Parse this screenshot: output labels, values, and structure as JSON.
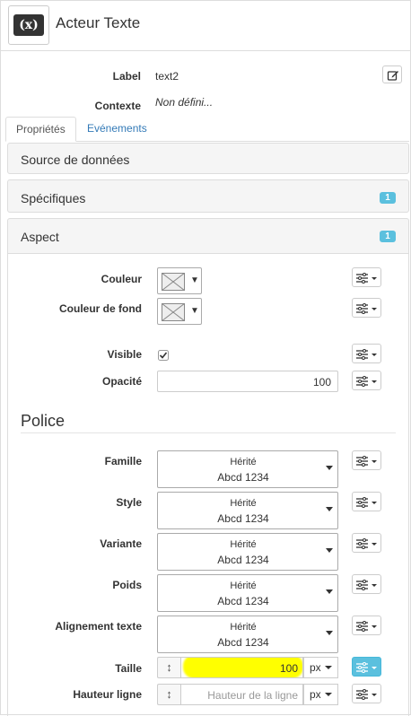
{
  "header": {
    "icon_text": "(x)",
    "title": "Acteur Texte"
  },
  "meta": {
    "label_label": "Label",
    "label_value": "text2",
    "contexte_label": "Contexte",
    "contexte_value": "Non défini..."
  },
  "tabs": [
    {
      "label": "Propriétés",
      "active": true
    },
    {
      "label": "Evénements",
      "active": false
    }
  ],
  "panels": {
    "source": {
      "title": "Source de données"
    },
    "specifiques": {
      "title": "Spécifiques",
      "badge": "1"
    },
    "aspect": {
      "title": "Aspect",
      "badge": "1"
    }
  },
  "aspect": {
    "couleur_label": "Couleur",
    "couleur_fond_label": "Couleur de fond",
    "visible_label": "Visible",
    "visible_checked": true,
    "opacite_label": "Opacité",
    "opacite_value": "100"
  },
  "police": {
    "heading": "Police",
    "rows": [
      {
        "label": "Famille",
        "line1": "Hérité",
        "line2": "Abcd 1234"
      },
      {
        "label": "Style",
        "line1": "Hérité",
        "line2": "Abcd 1234"
      },
      {
        "label": "Variante",
        "line1": "Hérité",
        "line2": "Abcd 1234"
      },
      {
        "label": "Poids",
        "line1": "Hérité",
        "line2": "Abcd 1234"
      },
      {
        "label": "Alignement texte",
        "line1": "Hérité",
        "line2": "Abcd 1234"
      }
    ],
    "taille": {
      "label": "Taille",
      "value": "100",
      "unit": "px"
    },
    "hauteur": {
      "label": "Hauteur ligne",
      "placeholder": "Hauteur de la ligne",
      "unit": "px"
    }
  },
  "colors": {
    "badge": "#5bc0de",
    "link": "#337ab7",
    "highlight": "#ffff00",
    "active_option": "#5bc0de"
  },
  "icons": {
    "app": "variable-icon",
    "edit": "edit-icon",
    "options": "sliders-icon",
    "swatch": "no-color-icon",
    "resize": "vertical-resize-icon"
  }
}
